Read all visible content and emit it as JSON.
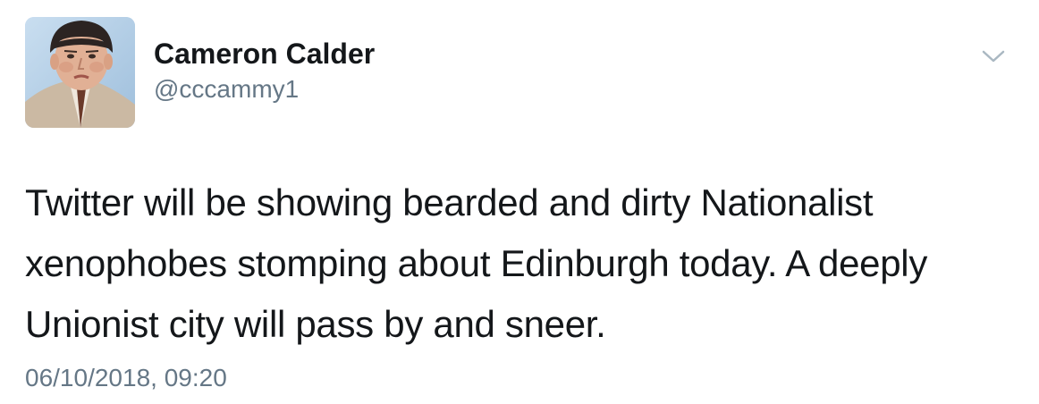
{
  "author": {
    "display_name": "Cameron Calder",
    "handle": "@cccammy1",
    "avatar_icon": "profile-photo"
  },
  "menu": {
    "icon": "chevron-down-icon",
    "color": "#aab8c2"
  },
  "tweet": {
    "lines": [
      "Twitter will be showing bearded and dirty Nationalist",
      "xenophobes stomping about Edinburgh today. A deeply",
      "Unionist city will pass by and sneer."
    ],
    "timestamp": "06/10/2018, 09:20"
  },
  "colors": {
    "text": "#14171a",
    "secondary": "#657786",
    "background": "#ffffff"
  }
}
